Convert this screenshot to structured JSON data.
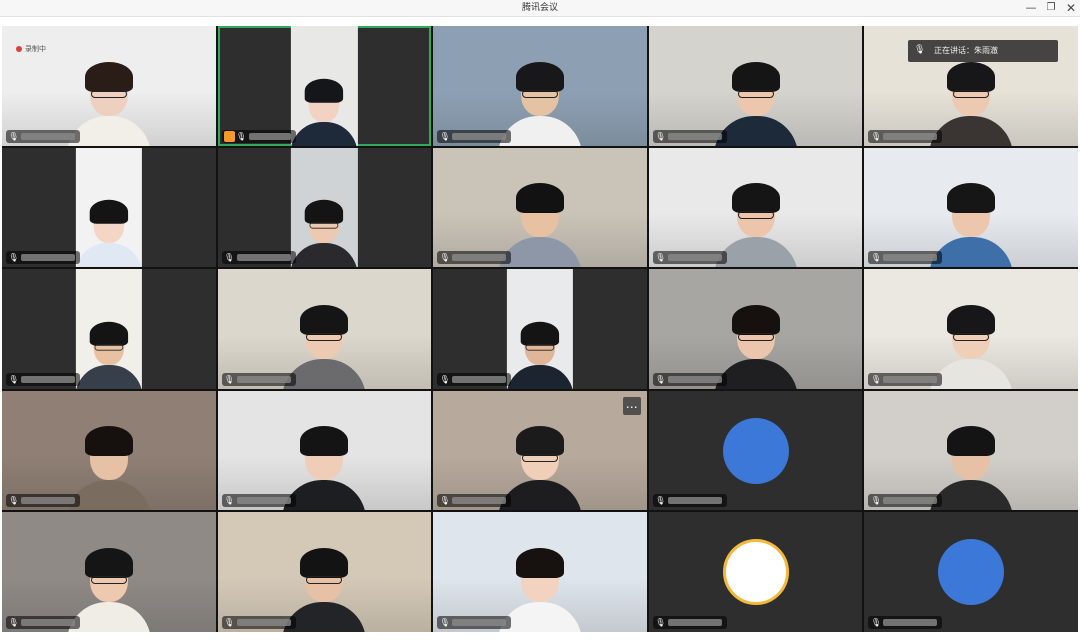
{
  "window": {
    "title": "腾讯会议",
    "minimize_icon": "minimize-icon",
    "restore_icon": "restore-icon",
    "close_icon": "close-icon"
  },
  "recording": {
    "label": "录制中",
    "color": "#e23c3c"
  },
  "speaking": {
    "label": "正在讲话：朱雨澈"
  },
  "colors": {
    "active_border": "#2faa5c",
    "grid_bg": "#121212",
    "tile_dark": "#2e2e2e",
    "avatar_blue": "#3b78d8"
  },
  "tiles": [
    {
      "kind": "video",
      "bg": "#eeeeee",
      "shirt": "#f2efe8",
      "skin": "#edd0c0",
      "hair": "#2a1d18",
      "glasses": true,
      "recording": true
    },
    {
      "kind": "portrait",
      "bg": "#2e2e2e",
      "pbg": "#e8e8e6",
      "shirt": "#1e2a3a",
      "skin": "#f1d2c3",
      "hair": "#15161a",
      "glasses": false,
      "active": true,
      "host": true
    },
    {
      "kind": "video",
      "bg": "#8da0b3",
      "shirt": "#f0f0f0",
      "skin": "#e4c2a4",
      "hair": "#18181b",
      "glasses": true
    },
    {
      "kind": "video",
      "bg": "#d4d3ce",
      "shirt": "#1d2a3a",
      "skin": "#edc6ae",
      "hair": "#151515",
      "glasses": true
    },
    {
      "kind": "video",
      "bg": "#e6e2d8",
      "shirt": "#3a3533",
      "skin": "#ecc9b0",
      "hair": "#17171a",
      "glasses": true,
      "speaking": true
    },
    {
      "kind": "portrait",
      "bg": "#2e2e2e",
      "pbg": "#f2f2f2",
      "shirt": "#e0e8f4",
      "skin": "#f4d6c6",
      "hair": "#141414",
      "glasses": false
    },
    {
      "kind": "portrait",
      "bg": "#2e2e2e",
      "pbg": "#cfd3d6",
      "shirt": "#2a2a2e",
      "skin": "#ecc9b0",
      "hair": "#141414",
      "glasses": true
    },
    {
      "kind": "video",
      "bg": "#c9c3b8",
      "shirt": "#8d97a8",
      "skin": "#e8c1a3",
      "hair": "#121212",
      "glasses": false
    },
    {
      "kind": "video",
      "bg": "#e9e9e9",
      "shirt": "#9ba1a8",
      "skin": "#ecc5ab",
      "hair": "#151515",
      "glasses": true
    },
    {
      "kind": "video",
      "bg": "#e7ebf0",
      "shirt": "#3f6fa8",
      "skin": "#ecc7ad",
      "hair": "#161616",
      "glasses": false
    },
    {
      "kind": "portrait",
      "bg": "#2e2e2e",
      "pbg": "#f1efe9",
      "shirt": "#37404a",
      "skin": "#e7c1a2",
      "hair": "#141414",
      "glasses": true
    },
    {
      "kind": "video",
      "bg": "#dcd7cc",
      "shirt": "#6b6b6e",
      "skin": "#edcbb2",
      "hair": "#151515",
      "glasses": true
    },
    {
      "kind": "portrait",
      "bg": "#2e2e2e",
      "pbg": "#e9eaeb",
      "shirt": "#1c2430",
      "skin": "#dfb698",
      "hair": "#141414",
      "glasses": true
    },
    {
      "kind": "video",
      "bg": "#a8a6a2",
      "shirt": "#1f1f22",
      "skin": "#ecc6ac",
      "hair": "#16110f",
      "glasses": true
    },
    {
      "kind": "video",
      "bg": "#ebe7e1",
      "shirt": "#e7e5e0",
      "skin": "#efcfb8",
      "hair": "#17171a",
      "glasses": true
    },
    {
      "kind": "video",
      "bg": "#8f7f74",
      "shirt": "#7b6c60",
      "skin": "#e7c1a6",
      "hair": "#16110f",
      "glasses": false
    },
    {
      "kind": "video",
      "bg": "#e4e4e4",
      "shirt": "#1c1e22",
      "skin": "#efcdb6",
      "hair": "#141414",
      "glasses": false
    },
    {
      "kind": "video",
      "bg": "#b7a99c",
      "shirt": "#1d1d1f",
      "skin": "#f0cfb9",
      "hair": "#1b1b1b",
      "glasses": true,
      "more": true
    },
    {
      "kind": "avatar",
      "bg": "#2e2e2e",
      "avatar": "#3b78d8"
    },
    {
      "kind": "video",
      "bg": "#d2cfca",
      "shirt": "#2a2a2a",
      "skin": "#e7c1a6",
      "hair": "#141414",
      "glasses": false
    },
    {
      "kind": "video",
      "bg": "#8f8a86",
      "shirt": "#f0ece6",
      "skin": "#edc9b0",
      "hair": "#151515",
      "glasses": true
    },
    {
      "kind": "video",
      "bg": "#d4c9b7",
      "shirt": "#232428",
      "skin": "#e7c1a6",
      "hair": "#131313",
      "glasses": true
    },
    {
      "kind": "video",
      "bg": "#dfe5ec",
      "shirt": "#f4f4f4",
      "skin": "#f1d3c0",
      "hair": "#17110f",
      "glasses": false
    },
    {
      "kind": "avatar",
      "bg": "#2e2e2e",
      "avatar": "#ffffff",
      "avatar_ring": "#f4b83a"
    },
    {
      "kind": "avatar",
      "bg": "#2e2e2e",
      "avatar": "#3b78d8"
    }
  ]
}
